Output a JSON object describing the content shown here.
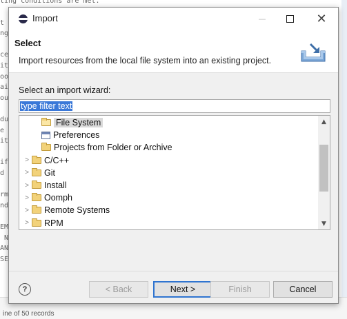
{
  "window": {
    "title": "Import",
    "minimize_glyph": "—",
    "close_glyph": "✕"
  },
  "header": {
    "title": "Select",
    "description": "Import resources from the local file system into an existing project."
  },
  "wizard": {
    "label": "Select an import wizard:",
    "filter_value": "type filter text"
  },
  "tree": {
    "items": [
      {
        "label": "File System",
        "icon": "folder-open-icon",
        "level": 1,
        "selected": true
      },
      {
        "label": "Preferences",
        "icon": "preferences-icon",
        "level": 1,
        "selected": false
      },
      {
        "label": "Projects from Folder or Archive",
        "icon": "folder-icon",
        "level": 1,
        "selected": false
      },
      {
        "label": "C/C++",
        "icon": "folder-icon",
        "level": 0,
        "twisty": ">"
      },
      {
        "label": "Git",
        "icon": "folder-icon",
        "level": 0,
        "twisty": ">"
      },
      {
        "label": "Install",
        "icon": "folder-icon",
        "level": 0,
        "twisty": ">"
      },
      {
        "label": "Oomph",
        "icon": "folder-icon",
        "level": 0,
        "twisty": ">"
      },
      {
        "label": "Remote Systems",
        "icon": "folder-icon",
        "level": 0,
        "twisty": ">"
      },
      {
        "label": "RPM",
        "icon": "folder-icon",
        "level": 0,
        "twisty": ">"
      }
    ]
  },
  "buttons": {
    "help": "?",
    "back": "< Back",
    "next": "Next >",
    "finish": "Finish",
    "cancel": "Cancel"
  },
  "background": {
    "lines": [
      "ting conditions are met.",
      "t",
      "ng",
      "",
      "ce",
      "it",
      "oo",
      "ai",
      "ou",
      "",
      "du",
      "e",
      "it",
      "",
      "if",
      "d",
      "",
      "rm",
      "nd,",
      "",
      "EM",
      " N",
      "AN",
      "SE"
    ],
    "status_text": "ine of 50 records"
  },
  "colors": {
    "selection": "#3a78d8",
    "default_button_border": "#2f74d0"
  }
}
